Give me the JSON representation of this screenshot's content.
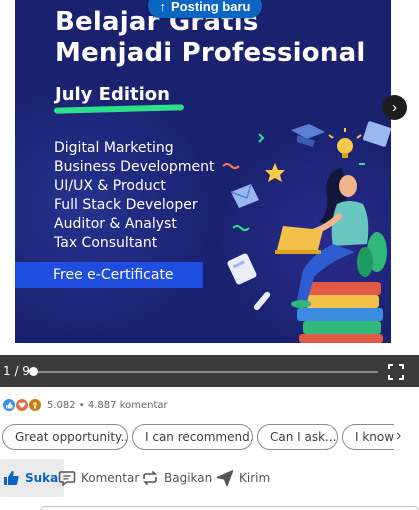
{
  "slide": {
    "headline_line1": "Belajar Gratis",
    "headline_line2": "Menjadi Professional",
    "edition": "July Edition",
    "topics": [
      "Digital Marketing",
      "Business Development",
      "UI/UX & Product",
      "Full Stack Developer",
      "Auditor & Analyst",
      "Tax Consultant"
    ],
    "certificate": "Free e-Certificate"
  },
  "posting_button": {
    "label": "Posting baru",
    "icon": "arrow-up-icon"
  },
  "carousel": {
    "page_counter": "1 / 9",
    "current_page": 1,
    "total_pages": 9,
    "progress": 0.0
  },
  "reactions": {
    "icons": [
      "like-icon",
      "love-icon",
      "support-icon"
    ],
    "summary": "5.082 • 4.887 komentar"
  },
  "suggestions": [
    "Great opportunity...",
    "I can recommend...",
    "Can I ask...",
    "I know"
  ],
  "actions": {
    "like": "Suka",
    "comment": "Komentar",
    "repost": "Bagikan",
    "send": "Kirim"
  },
  "colors": {
    "slide_bg": "#1a2270",
    "accent_green": "#2de08a",
    "cert_blue": "#1f4de0",
    "linkedin_blue": "#0a66c2"
  }
}
